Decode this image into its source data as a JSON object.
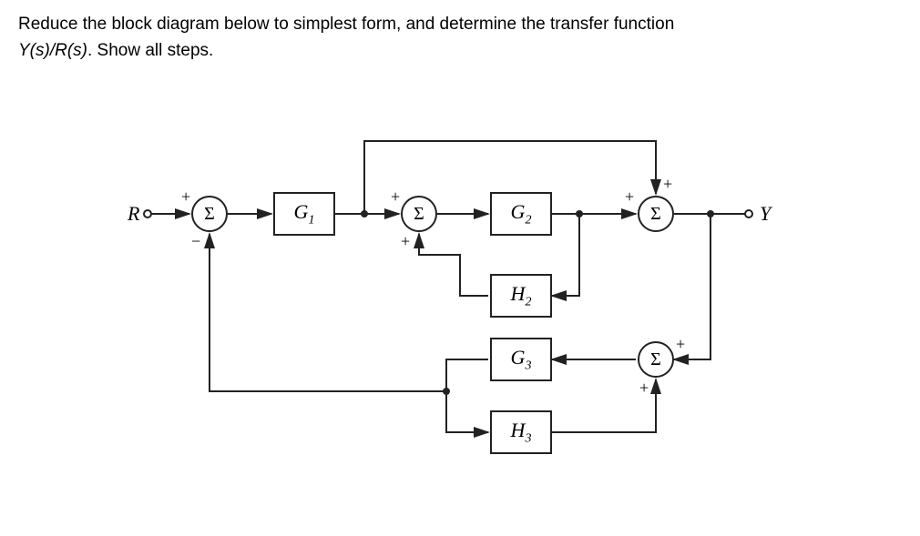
{
  "prompt": {
    "line1_prefix": "Reduce the block diagram below to simplest form, and determine the transfer function",
    "line2_expr": "Y(s)/R(s)",
    "line2_suffix": ".  Show all steps."
  },
  "diagram": {
    "input_label": "R",
    "output_label": "Y",
    "sum_symbol": "Σ",
    "blocks": {
      "G1": "G",
      "G1_sub": "1",
      "G2": "G",
      "G2_sub": "2",
      "G3": "G",
      "G3_sub": "3",
      "H2": "H",
      "H2_sub": "2",
      "H3": "H",
      "H3_sub": "3"
    },
    "signs": {
      "s1_top": "+",
      "s1_bot": "−",
      "s2_top": "+",
      "s2_bot": "+",
      "s3_top": "+",
      "s3_right": "+",
      "s4_top": "+",
      "s4_bot": "+"
    }
  }
}
